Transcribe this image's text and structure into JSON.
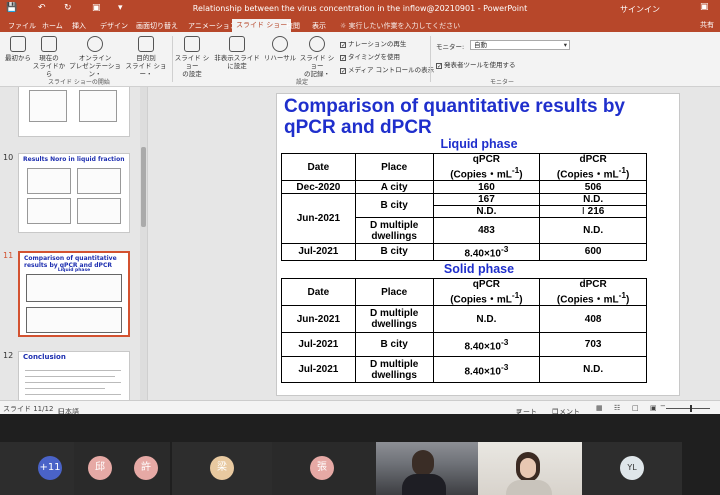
{
  "window": {
    "title": "Relationship between the virus concentration in the inflow@20210901 - PowerPoint",
    "user": "サインイン"
  },
  "ribbon_tabs": [
    "ファイル",
    "ホーム",
    "挿入",
    "デザイン",
    "画面切り替え",
    "アニメーション",
    "スライド ショー",
    "校閲",
    "表示"
  ],
  "active_tab": "スライド ショー",
  "tell_me": "実行したい作業を入力してください",
  "share": "共有",
  "ribbon": {
    "btn_from_start": "最初から",
    "btn_from_current": [
      "現在の",
      "スライドから"
    ],
    "btn_online": [
      "オンライン",
      "プレゼンテーション・"
    ],
    "btn_custom": [
      "目的別",
      "スライド ショー・"
    ],
    "group_start": "スライド ショーの開始",
    "btn_setup": [
      "スライド ショー",
      "の設定"
    ],
    "btn_hide": [
      "非表示スライド",
      "に設定"
    ],
    "btn_rehearse": "リハーサル",
    "btn_record": [
      "スライド ショー",
      "の記録・"
    ],
    "chk_narration": "ナレーションの再生",
    "chk_timing": "タイミングを使用",
    "chk_media": "メディア コントロールの表示",
    "group_setup": "設定",
    "monitor_label": "モニター:",
    "monitor_value": "自動",
    "chk_presenter": "発表者ツールを使用する",
    "group_monitor": "モニター"
  },
  "thumbnails": [
    {
      "num": "10",
      "title": "Results  Noro in liquid fraction"
    },
    {
      "num": "11",
      "title": "Comparison of quantitative results by qPCR and dPCR",
      "sub": "Liquid phase"
    },
    {
      "num": "12",
      "title": "Conclusion"
    }
  ],
  "slide": {
    "title": "Comparison of quantitative results by qPCR and dPCR",
    "liquid_phase": "Liquid phase",
    "solid_phase": "Solid phase",
    "headers": {
      "date": "Date",
      "place": "Place",
      "qpcr": "qPCR",
      "dpcr": "dPCR",
      "units": "(Copies・mL",
      "units_sup": "-1",
      "units_end": ")"
    },
    "liquid": {
      "r1": {
        "date": "Dec-2020",
        "place": "A city",
        "q": "160",
        "d": "506"
      },
      "r2": {
        "date": "Jun-2021",
        "place": "B city",
        "q1": "167",
        "d1": "N.D.",
        "q2": "N.D.",
        "d2": "216"
      },
      "r3": {
        "place": "D multiple dwellings",
        "q": "483",
        "d": "N.D."
      },
      "r4": {
        "date": "Jul-2021",
        "place": "B city",
        "q": "8.40×10",
        "q_sup": "-3",
        "d": "600"
      }
    },
    "solid": {
      "r1": {
        "date": "Jun-2021",
        "place": "D multiple dwellings",
        "q": "N.D.",
        "d": "408"
      },
      "r2": {
        "date": "Jul-2021",
        "place": "B city",
        "q": "8.40×10",
        "q_sup": "-3",
        "d": "703"
      },
      "r3": {
        "date": "Jul-2021",
        "place": "D multiple dwellings",
        "q": "8.40×10",
        "q_sup": "-3",
        "d": "N.D."
      }
    }
  },
  "status": {
    "slide": "スライド 11/12",
    "lang": "日本語",
    "notes": "ノート",
    "comments": "コメント"
  },
  "participants": [
    {
      "label": "+11",
      "color": "#4a63c8"
    },
    {
      "label": "邱",
      "color": "#e6a9a5"
    },
    {
      "label": "許",
      "color": "#e6a9a5"
    },
    {
      "label": "梁",
      "color": "#e8c9a0"
    },
    {
      "label": "張",
      "color": "#e6a9a5"
    },
    {
      "label": "YL",
      "color": "#dfe6ea"
    }
  ]
}
